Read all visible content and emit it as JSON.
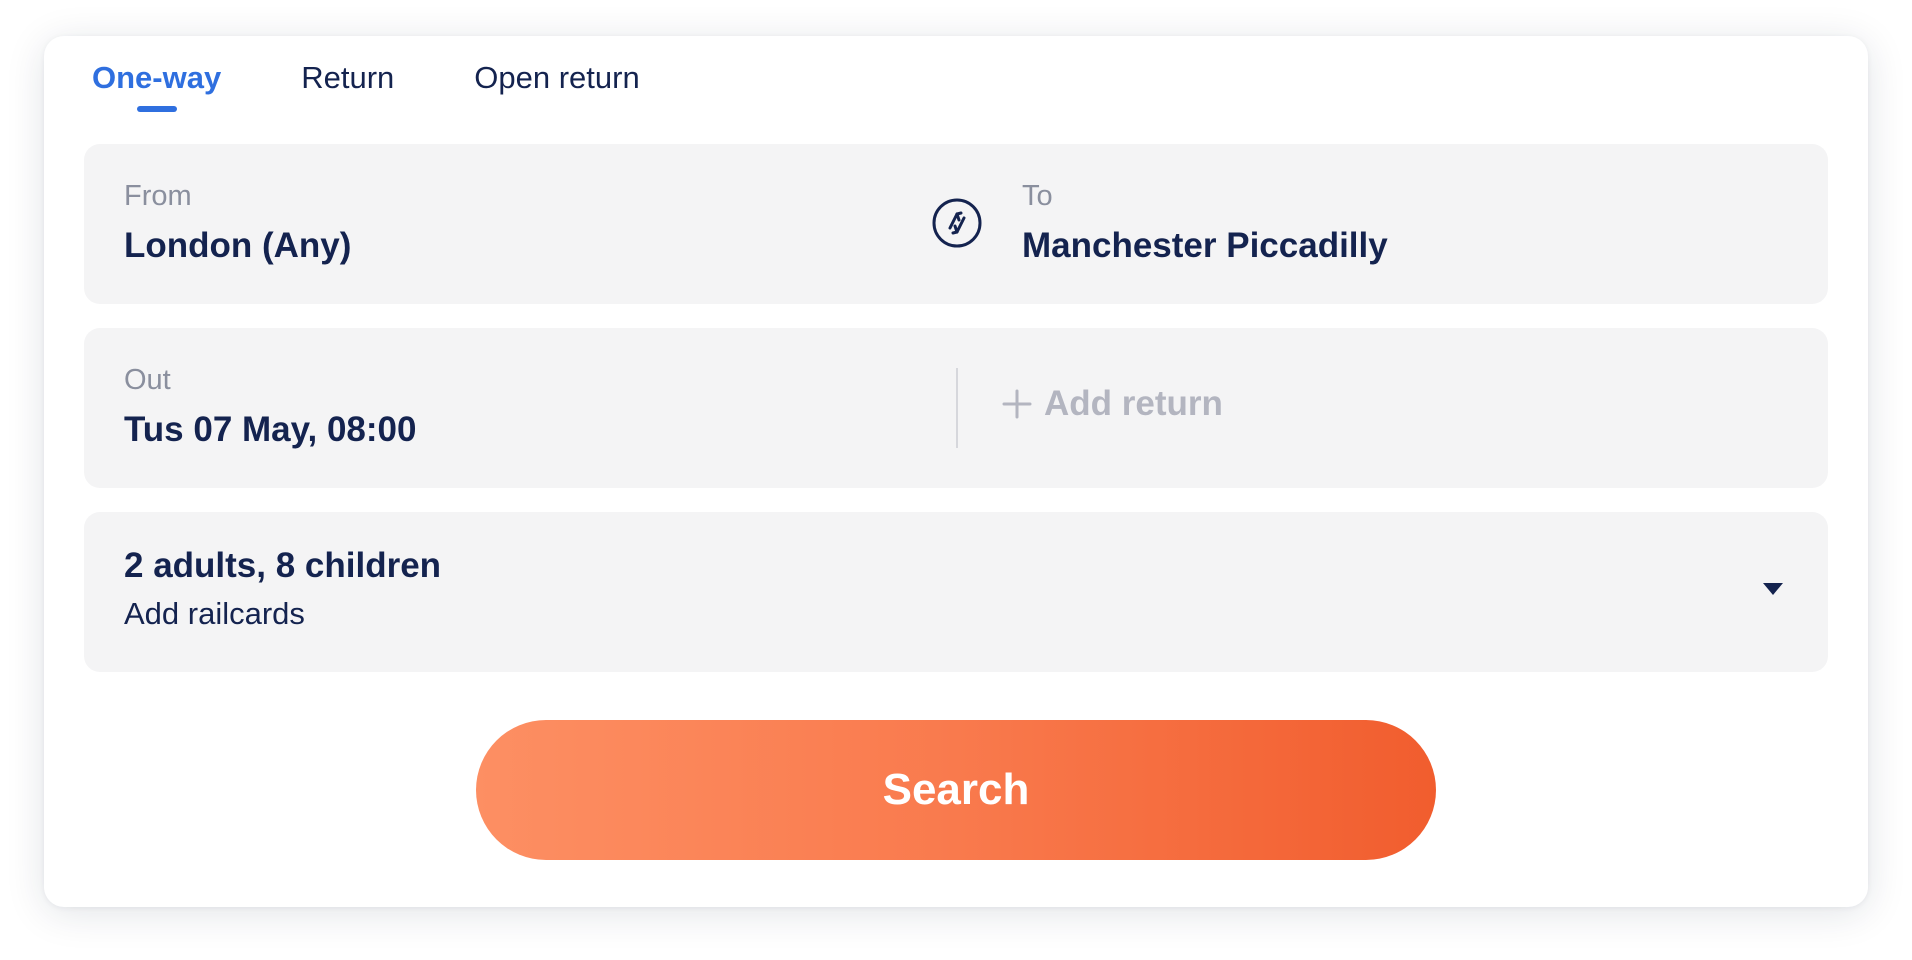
{
  "tabs": [
    {
      "label": "One-way",
      "active": true
    },
    {
      "label": "Return",
      "active": false
    },
    {
      "label": "Open return",
      "active": false
    }
  ],
  "route": {
    "from_label": "From",
    "from_value": "London (Any)",
    "to_label": "To",
    "to_value": "Manchester Piccadilly",
    "swap_icon": "swap-stations-icon"
  },
  "dates": {
    "out_label": "Out",
    "out_value": "Tus 07 May, 08:00",
    "add_return_label": "Add return",
    "add_return_icon": "plus-icon"
  },
  "passengers": {
    "summary": "2 adults, 8 children",
    "railcards_label": "Add railcards",
    "dropdown_icon": "caret-down-icon"
  },
  "actions": {
    "search_label": "Search"
  },
  "colors": {
    "primary_text": "#14234f",
    "active_tab": "#2f6fdf",
    "muted_label": "#8a8f9e",
    "disabled_text": "#b3b5c0",
    "field_background": "#f4f4f5",
    "search_gradient_start": "#fd8f63",
    "search_gradient_end": "#f15d2e"
  }
}
